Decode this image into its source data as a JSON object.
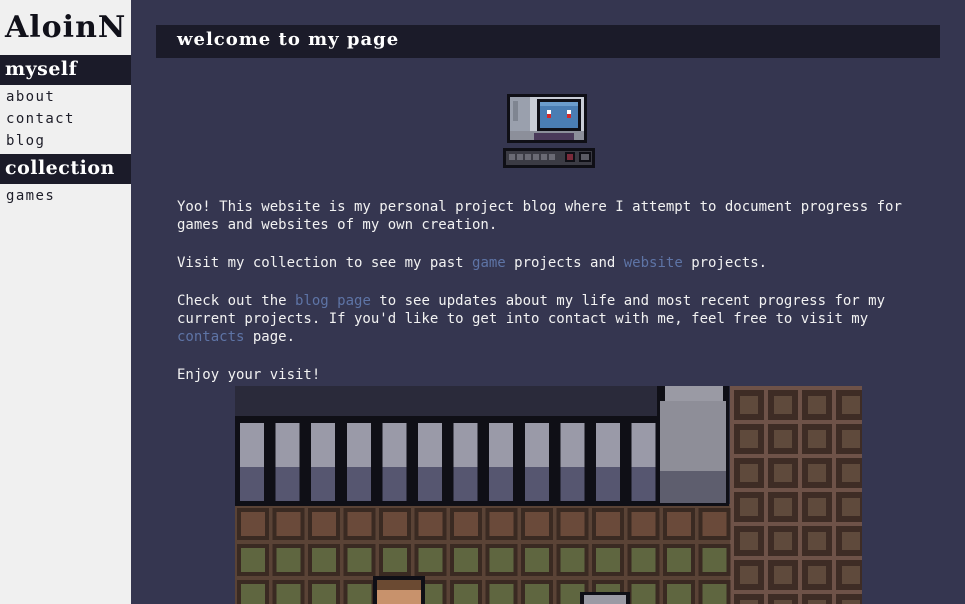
{
  "sidebar": {
    "logo": "AloinN",
    "sections": [
      {
        "title": "myself",
        "links": [
          "about",
          "contact",
          "blog"
        ]
      },
      {
        "title": "collection",
        "links": [
          "games"
        ]
      }
    ]
  },
  "main": {
    "title": "welcome to my page",
    "paragraphs": {
      "p1": "Yoo! This website is my personal project blog where I attempt to document progress for games and websites of my own creation.",
      "p2_a": "Visit my collection to see my past ",
      "p2_link1": "game",
      "p2_b": " projects and ",
      "p2_link2": "website",
      "p2_c": " projects.",
      "p3_a": "Check out the ",
      "p3_link1": "blog page",
      "p3_b": " to see updates about my life and most recent progress for my current projects. If you'd like to get into contact with me, feel free to visit my ",
      "p3_link2": "contacts",
      "p3_c": " page.",
      "p4": "Enjoy your visit!"
    }
  },
  "colors": {
    "background": "#353650",
    "sidebar": "#f0f0f0",
    "header": "#1b1b29",
    "link": "#5e74a6"
  },
  "icons": [
    "robot-computer-icon",
    "pixel-game-screenshot"
  ]
}
